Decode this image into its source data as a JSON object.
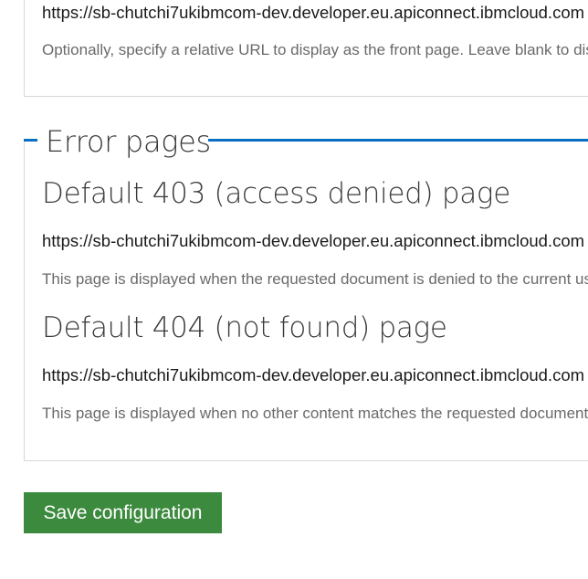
{
  "front_page": {
    "url_value": "https://sb-chutchi7ukibmcom-dev.developer.eu.apiconnect.ibmcloud.com",
    "description": "Optionally, specify a relative URL to display as the front page. Leave blank to display the default front page."
  },
  "error_pages": {
    "legend": "Error pages",
    "page_403": {
      "heading": "Default 403 (access denied) page",
      "url_value": "https://sb-chutchi7ukibmcom-dev.developer.eu.apiconnect.ibmcloud.com",
      "description": "This page is displayed when the requested document is denied to the current user. Leave blank to display a generic \"access denied\" page."
    },
    "page_404": {
      "heading": "Default 404 (not found) page",
      "url_value": "https://sb-chutchi7ukibmcom-dev.developer.eu.apiconnect.ibmcloud.com",
      "description": "This page is displayed when no other content matches the requested document. Leave blank to display a generic \"page not found\" page."
    }
  },
  "actions": {
    "save_label": "Save configuration"
  },
  "colors": {
    "legend_rule": "#0a6fc2",
    "save_button": "#3c8a3e"
  }
}
